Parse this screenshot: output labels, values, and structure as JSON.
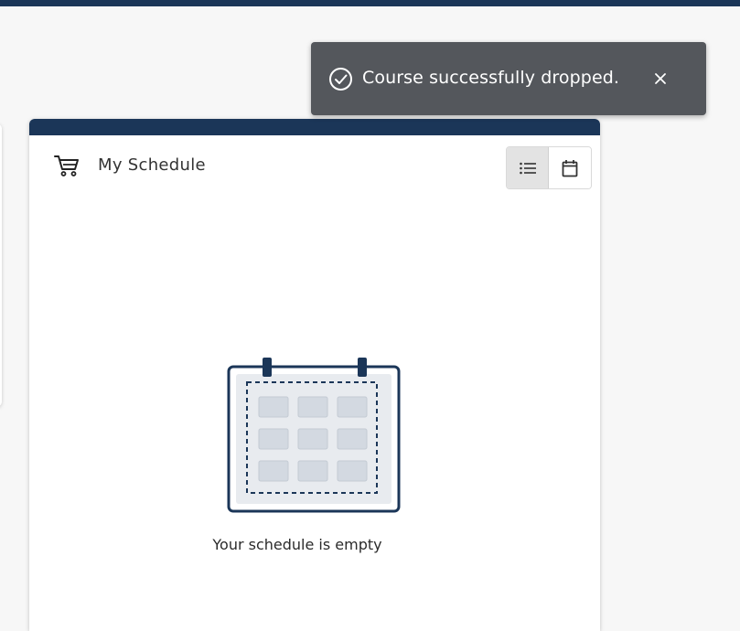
{
  "toast": {
    "message": "Course successfully dropped.",
    "icon": "check-circle-icon",
    "close_icon": "close-icon",
    "background": "#54575c"
  },
  "schedule_card": {
    "title": "My Schedule",
    "title_icon": "shopping-cart-icon",
    "accent_color": "#1b3658",
    "view_toggle": {
      "options": [
        {
          "name": "list-view",
          "icon": "list-icon",
          "active": true
        },
        {
          "name": "calendar-view",
          "icon": "calendar-icon",
          "active": false
        }
      ]
    },
    "empty_state": {
      "message": "Your schedule is empty",
      "illustration": "calendar-illustration"
    }
  }
}
